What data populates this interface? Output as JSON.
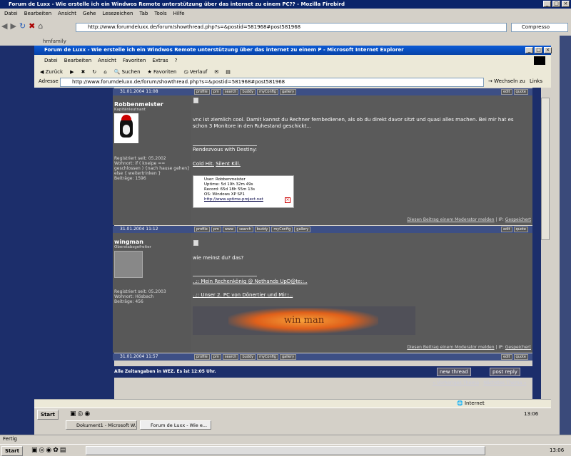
{
  "firebird": {
    "title": "Forum de Luxx - Wie erstelle ich ein Windwos Remote unterstützung über das internet zu einem PC?? - Mozilla Firebird",
    "menu": [
      "Datei",
      "Bearbeiten",
      "Ansicht",
      "Gehe",
      "Lesezeichen",
      "Tab",
      "Tools",
      "Hilfe"
    ],
    "url": "http://www.forumdeluxx.de/forum/showthread.php?s=&postid=581968#post581968",
    "search_engine": "Compresso",
    "bookmarks_item": "hmfamily",
    "status": "Fertig"
  },
  "ie": {
    "title": "Forum de Luxx - Wie erstelle ich ein Windwos Remote unterstützung über das internet zu einem P - Microsoft Internet Explorer",
    "menu": [
      "Datei",
      "Bearbeiten",
      "Ansicht",
      "Favoriten",
      "Extras",
      "?"
    ],
    "back": "Zurück",
    "search": "Suchen",
    "favorites": "Favoriten",
    "history": "Verlauf",
    "address_label": "Adresse",
    "url": "http://www.forumdeluxx.de/forum/showthread.php?s=&postid=581968#post581968",
    "go": "Wechseln zu",
    "links": "Links",
    "status_zone": "Internet"
  },
  "posts": [
    {
      "date": "31.01.2004 11:08",
      "buttons": [
        "profile",
        "pm",
        "search",
        "buddy",
        "myConfig",
        "gallery"
      ],
      "quick": [
        "edit",
        "quote"
      ]
    },
    {
      "username": "Robbenmeister",
      "rank": "Kapitänleutnant",
      "registered": "Registriert seit: 05.2002",
      "location": "Wohnort: if ( kneipe == geschlossen ) {nach hause gehen} else { weitertrinken }",
      "posts": "Beiträge: 1596",
      "message": "vnc ist ziemlich cool. Damit kannst du Rechner fernbedienen, als ob du direkt davor sitzt und quasi alles machen. Bei mir hat es schon 3 Monitore in den Ruhestand geschickt...",
      "sig_title": "Rendezvous with Destiny:",
      "sig_links": [
        "Cold Hit.",
        "Silent Kill."
      ],
      "uptime": {
        "user": "User: Robbenmeister",
        "uptime": "Uptime: 5d 19h 32m 49s",
        "record": "Record: 65d 18h 55m 13s",
        "os": "OS: Windows XP SP1",
        "url": "http://www.uptime-project.net"
      },
      "report": "Diesen Beitrag einem Moderator melden",
      "ip": "IP:",
      "ip_link": "Gespeichert"
    },
    {
      "date": "31.01.2004 11:12",
      "buttons": [
        "profile",
        "pm",
        "www",
        "search",
        "buddy",
        "myConfig",
        "gallery"
      ],
      "quick": [
        "edit",
        "quote"
      ]
    },
    {
      "username": "wingman",
      "rank": "Oberstabsgefreiter",
      "registered": "Registriert seit: 05.2003",
      "location": "Wohnort: Hösbach",
      "posts": "Beiträge: 456",
      "message": "wie meinst du? das?",
      "sig_links": [
        "..:: Mein Rechenkönig @ Nethands UpD@te::..",
        "..:: Unser 2. PC von Dönertier und Mir::.."
      ],
      "banner_text": "win man",
      "report": "Diesen Beitrag einem Moderator melden",
      "ip": "IP:",
      "ip_link": "Gespeichert"
    },
    {
      "date": "31.01.2004 11:57",
      "buttons": [
        "profile",
        "pm",
        "search",
        "buddy",
        "myConfig",
        "gallery"
      ],
      "quick": [
        "edit",
        "quote"
      ]
    }
  ],
  "footer": {
    "timezone": "Alle Zeitangaben in WEZ. Es ist 12:05 Uhr.",
    "new_thread": "new thread",
    "post_reply": "post reply",
    "prev": "« Vorheriges Thema",
    "next": "Nächstes Thema »"
  },
  "taskbar_inner": {
    "start": "Start",
    "items": [
      "Dokument1 - Microsoft W...",
      "Forum de Luxx - Wie e..."
    ],
    "clock": "13:06"
  },
  "taskbar_outer": {
    "start": "Start",
    "clock": "13:06"
  },
  "colors": {
    "firebird_title": "#0a246a",
    "ie_title": "#0843a8",
    "forum_bg": "#5a5a5a",
    "post_header": "#3d4f85"
  }
}
